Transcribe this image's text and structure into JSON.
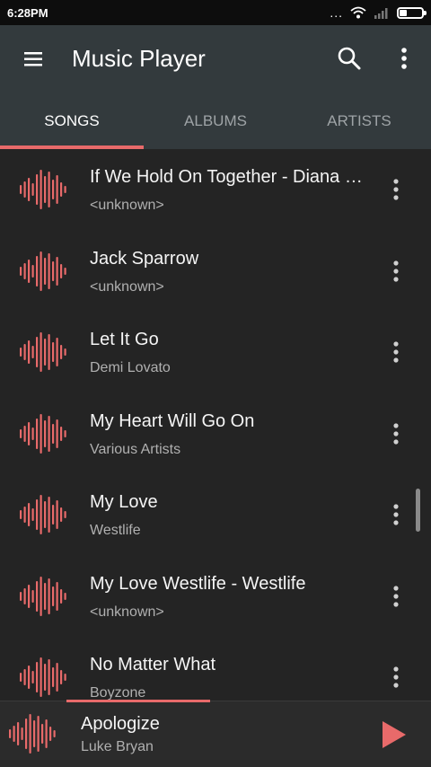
{
  "status_bar": {
    "time": "6:28PM",
    "dots": "...",
    "icons": [
      "wifi-icon",
      "signal-icon",
      "battery-icon"
    ]
  },
  "app_bar": {
    "title": "Music Player",
    "icons": [
      "menu-icon",
      "search-icon",
      "more-vert-icon"
    ]
  },
  "tabs": [
    {
      "label": "SONGS",
      "active": true
    },
    {
      "label": "ALBUMS",
      "active": false
    },
    {
      "label": "ARTISTS",
      "active": false
    }
  ],
  "songs": [
    {
      "title": "If We Hold On Together - Diana Ross",
      "artist": "<unknown>"
    },
    {
      "title": "Jack Sparrow",
      "artist": "<unknown>"
    },
    {
      "title": "Let It Go",
      "artist": "Demi Lovato"
    },
    {
      "title": "My Heart Will Go On",
      "artist": "Various Artists"
    },
    {
      "title": "My Love",
      "artist": "Westlife"
    },
    {
      "title": "My Love Westlife - Westlife",
      "artist": "<unknown>"
    },
    {
      "title": "No Matter What",
      "artist": "Boyzone"
    }
  ],
  "now_playing": {
    "title": "Apologize",
    "artist": "Luke Bryan",
    "icon": "play-icon"
  },
  "colors": {
    "accent": "#e86a6a",
    "app_bar": "#333a3d",
    "background": "#242424",
    "status_bar": "#0d0d0d"
  }
}
